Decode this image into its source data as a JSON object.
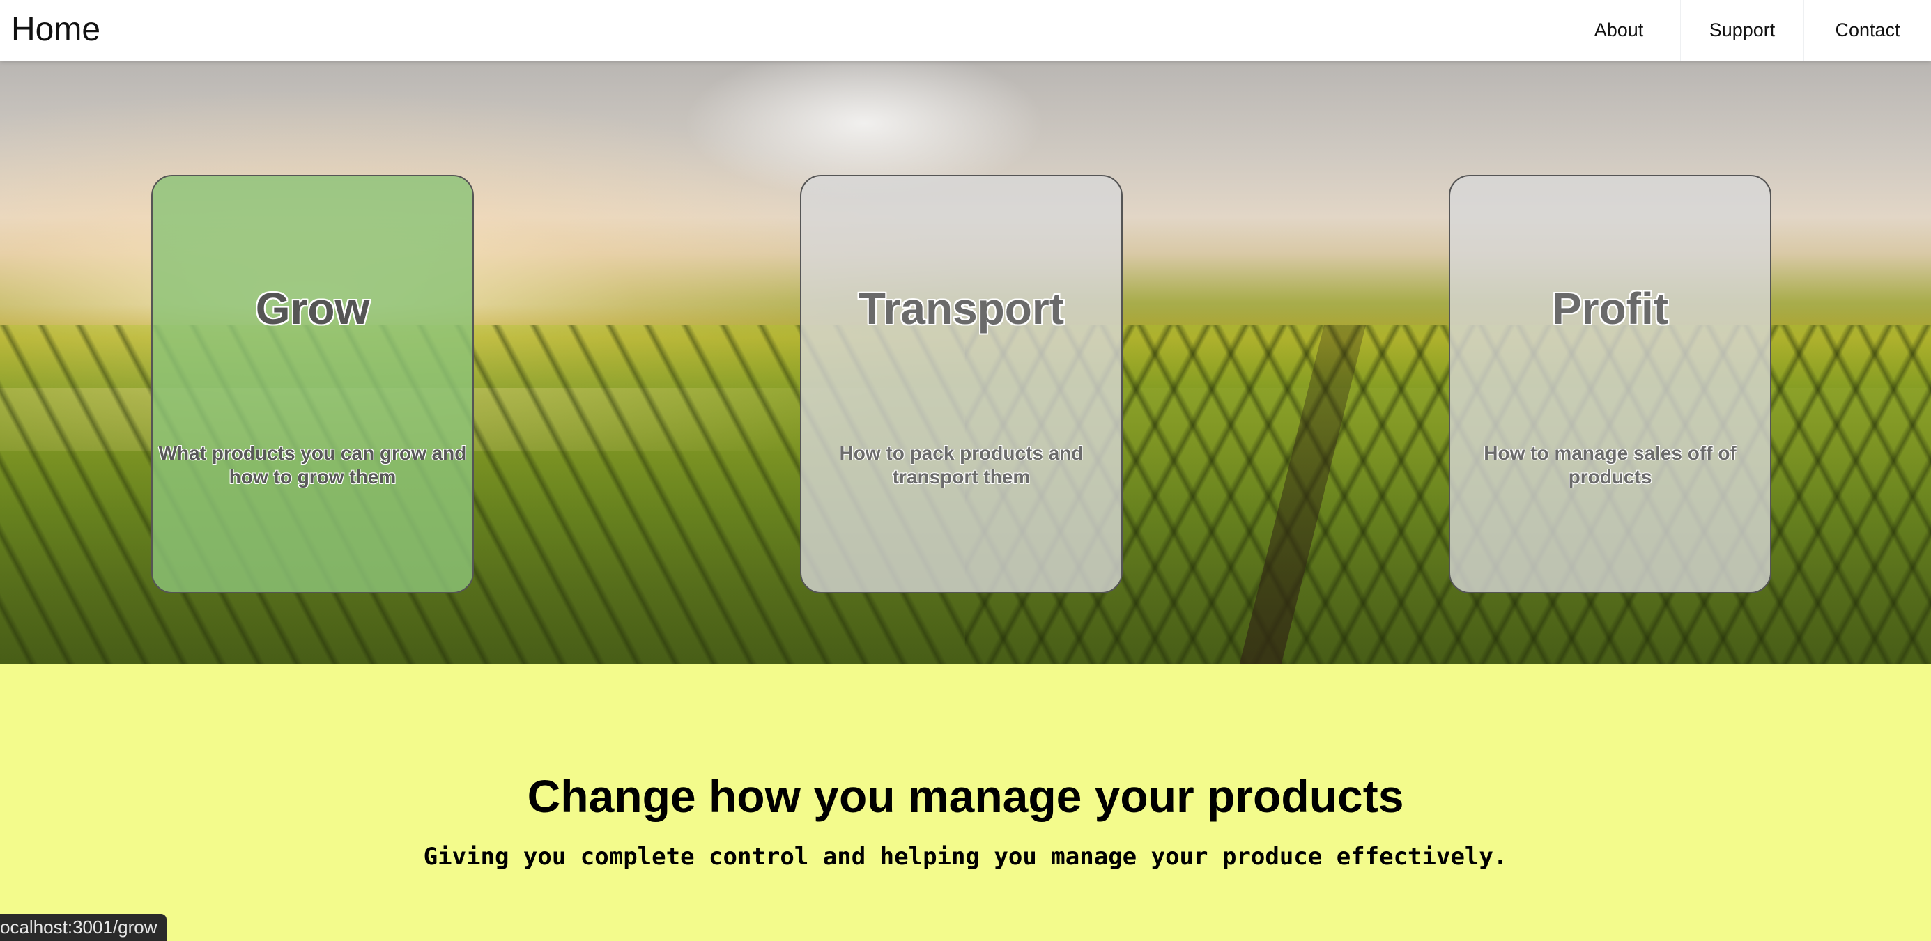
{
  "navbar": {
    "brand": "Home",
    "links": [
      {
        "label": "About"
      },
      {
        "label": "Support"
      },
      {
        "label": "Contact"
      }
    ]
  },
  "cards": [
    {
      "title": "Grow",
      "description": "What products you can grow and how to grow them",
      "highlighted": true
    },
    {
      "title": "Transport",
      "description": "How to pack products and transport them",
      "highlighted": false
    },
    {
      "title": "Profit",
      "description": "How to manage sales off of products",
      "highlighted": false
    }
  ],
  "section": {
    "headline": "Change how you manage your products",
    "subline": "Giving you complete control and helping you manage your produce effectively."
  },
  "status_bar": {
    "url": "ocalhost:3001/grow"
  },
  "colors": {
    "bottom_background": "#f3fb8c",
    "highlight_card": "#8cc378",
    "card_default": "#d7d7d7"
  }
}
